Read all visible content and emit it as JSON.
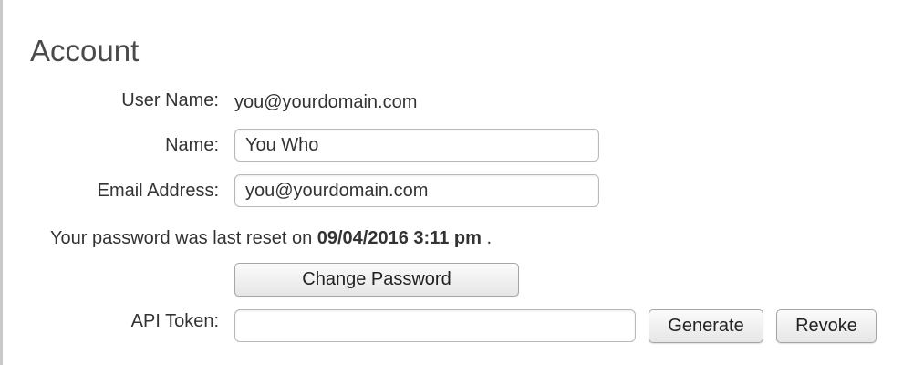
{
  "page": {
    "title": "Account"
  },
  "account": {
    "user_name_label": "User Name:",
    "user_name_value": "you@yourdomain.com",
    "name_label": "Name:",
    "name_value": "You Who",
    "email_label": "Email Address:",
    "email_value": "you@yourdomain.com"
  },
  "password": {
    "note_prefix": "Your password was last reset on",
    "reset_datetime": "09/04/2016 3:11 pm",
    "note_suffix": ".",
    "change_button_label": "Change Password"
  },
  "api_token": {
    "label": "API Token:",
    "value": "",
    "generate_button_label": "Generate",
    "revoke_button_label": "Revoke"
  }
}
